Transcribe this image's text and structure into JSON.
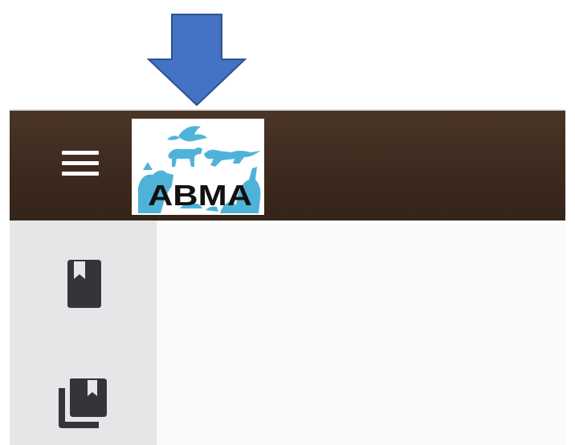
{
  "header": {
    "logo": {
      "text": "ABMA",
      "icon": "abma-animal-silhouettes-logo",
      "color_text": "#111111",
      "color_silhouettes": "#4fb3d9"
    },
    "menu_icon": "hamburger-menu-icon",
    "background_color": "#3f2b1f"
  },
  "annotation": {
    "icon": "down-arrow-callout",
    "color": "#4472c4"
  },
  "rail": {
    "items": [
      {
        "icon": "book-bookmark-icon"
      },
      {
        "icon": "library-books-bookmark-icon"
      }
    ],
    "background_color": "#e5e6e8"
  },
  "content": {
    "background_color": "#f8fafc"
  }
}
